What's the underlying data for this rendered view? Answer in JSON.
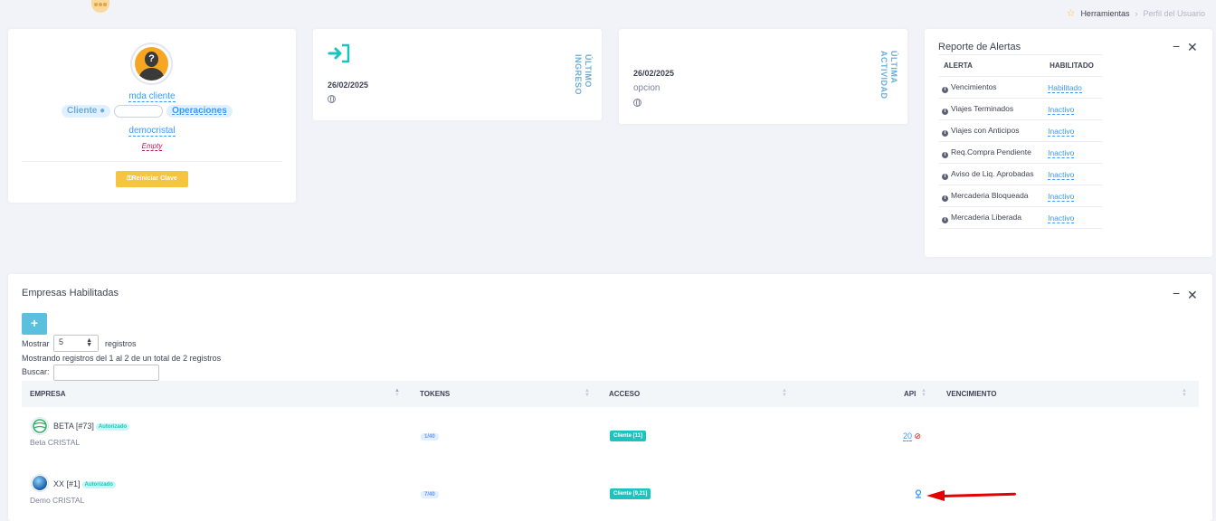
{
  "breadcrumb": {
    "items": [
      "Herramientas",
      "Perfil del Usuario"
    ]
  },
  "profile": {
    "name": "mda cliente",
    "role_badge": "Cliente",
    "operations_badge": "Operaciones",
    "username": "democristal",
    "empty_label": "Empty",
    "reset_button": "Reiniciar Clave"
  },
  "last_login": {
    "title": "ÚLTIMO INGRESO",
    "date": "26/02/2025"
  },
  "last_activity": {
    "title": "ÚLTIMA ACTIVIDAD",
    "date": "26/02/2025",
    "detail": "opcion"
  },
  "alerts": {
    "title": "Reporte de Alertas",
    "columns": [
      "ALERTA",
      "HABILITADO"
    ],
    "rows": [
      {
        "name": "Vencimientos",
        "status": "Habilitado"
      },
      {
        "name": "Viajes Terminados",
        "status": "Inactivo"
      },
      {
        "name": "Viajes con Anticipos",
        "status": "Inactivo"
      },
      {
        "name": "Req.Compra Pendiente",
        "status": "Inactivo"
      },
      {
        "name": "Aviso de Liq. Aprobadas",
        "status": "Inactivo"
      },
      {
        "name": "Mercaderia Bloqueada",
        "status": "Inactivo"
      },
      {
        "name": "Mercaderia Liberada",
        "status": "Inactivo"
      }
    ]
  },
  "companies": {
    "title": "Empresas Habilitadas",
    "add_label": "+",
    "show_label": "Mostrar",
    "page_size": "5",
    "records_label": "registros",
    "summary": "Mostrando registros del 1 al 2 de un total de 2 registros",
    "search_label": "Buscar:",
    "columns": [
      "EMPRESA",
      "TOKENS",
      "ACCESO",
      "API",
      "VENCIMIENTO"
    ],
    "rows": [
      {
        "name": "BETA [#73]",
        "badge": "Autorizado",
        "sub": "Beta CRISTAL",
        "tokens": "1/40",
        "access": "Cliente [11]",
        "api": "20"
      },
      {
        "name": "XX [#1]",
        "badge": "Autorizado",
        "sub": "Demo CRISTAL",
        "tokens": "7/40",
        "access": "Cliente [9,21]",
        "api": ""
      }
    ]
  },
  "colors": {
    "accent": "#3699ff",
    "success": "#1bc5bd",
    "warning": "#f6c343",
    "info": "#5bc0de",
    "annotation": "#e50000"
  }
}
